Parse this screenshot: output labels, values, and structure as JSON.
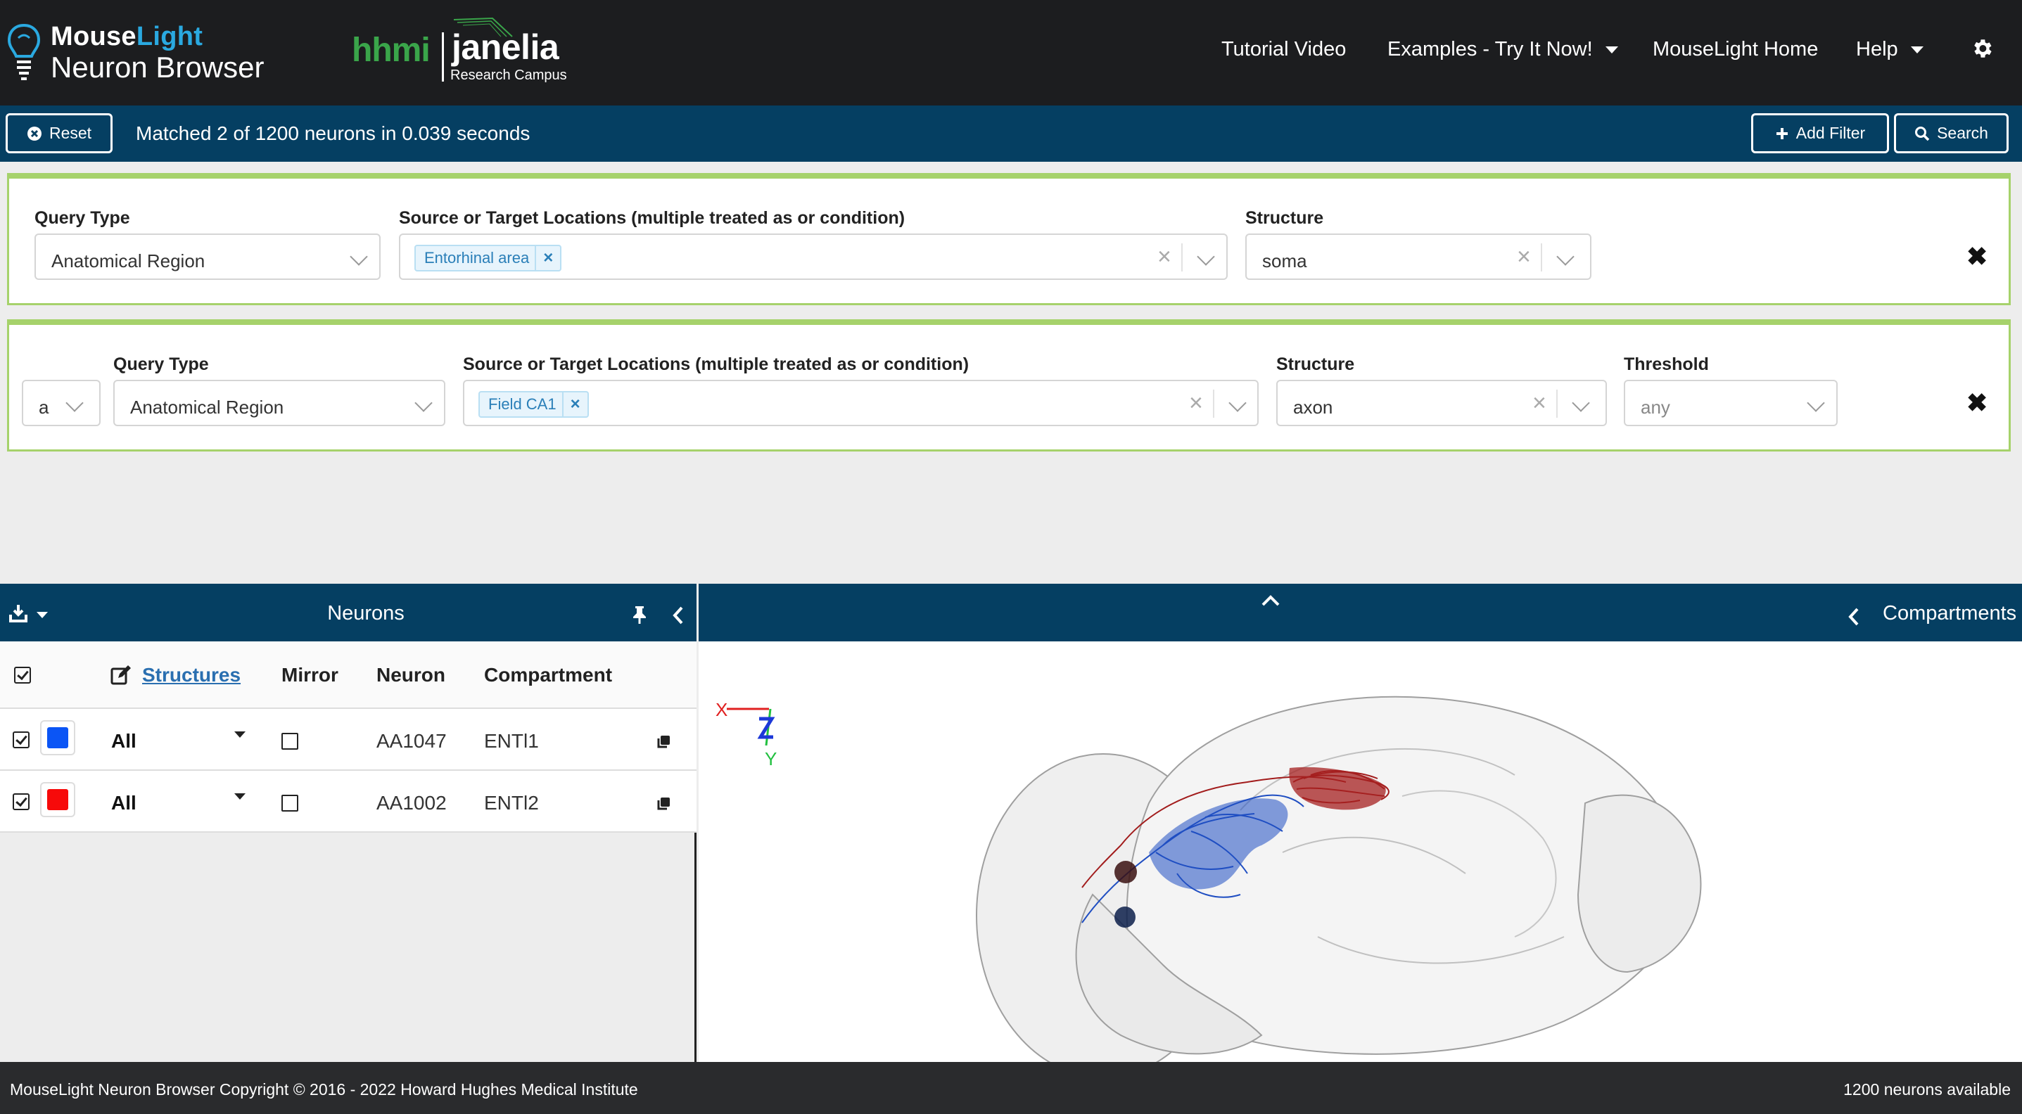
{
  "brand": {
    "mouse": "Mouse",
    "light": "Light",
    "subtitle": "Neuron Browser"
  },
  "logos": {
    "hhmi": "hhmi",
    "janelia": "janelia",
    "janelia_sub": "Research Campus"
  },
  "nav": {
    "tutorial": "Tutorial Video",
    "examples": "Examples - Try It Now!",
    "home": "MouseLight Home",
    "help": "Help"
  },
  "querybar": {
    "reset_label": "Reset",
    "match_text": "Matched 2 of 1200 neurons in 0.039 seconds",
    "add_filter_label": "Add Filter",
    "search_label": "Search"
  },
  "filters": [
    {
      "query_type_label": "Query Type",
      "query_type_value": "Anatomical Region",
      "locations_label": "Source or Target Locations (multiple treated as or condition)",
      "location_tag": "Entorhinal area",
      "structure_label": "Structure",
      "structure_value": "soma"
    },
    {
      "logic_value": "a",
      "query_type_label": "Query Type",
      "query_type_value": "Anatomical Region",
      "locations_label": "Source or Target Locations (multiple treated as or condition)",
      "location_tag": "Field CA1",
      "structure_label": "Structure",
      "structure_value": "axon",
      "threshold_label": "Threshold",
      "threshold_placeholder": "any"
    }
  ],
  "neurons_panel": {
    "title": "Neurons",
    "columns": {
      "structures": "Structures",
      "mirror": "Mirror",
      "neuron": "Neuron",
      "compartment": "Compartment"
    },
    "rows": [
      {
        "color": "#0b55f5",
        "structures": "All",
        "neuron": "AA1047",
        "compartment": "ENTl1",
        "checked": true,
        "mirror": false
      },
      {
        "color": "#f70a0a",
        "structures": "All",
        "neuron": "AA1002",
        "compartment": "ENTl2",
        "checked": true,
        "mirror": false
      }
    ]
  },
  "viewer": {
    "compartments_label": "Compartments",
    "axis_x": "X",
    "axis_y": "Y"
  },
  "footer": {
    "copyright": "MouseLight Neuron Browser Copyright © 2016 - 2022 Howard Hughes Medical Institute",
    "available": "1200 neurons available"
  },
  "colors": {
    "nav_bg": "#1c1d1f",
    "bar_bg": "#053f62",
    "filter_border": "#a6d26b",
    "brand_accent": "#2aa9e0",
    "hhmi_green": "#3aa54a"
  }
}
